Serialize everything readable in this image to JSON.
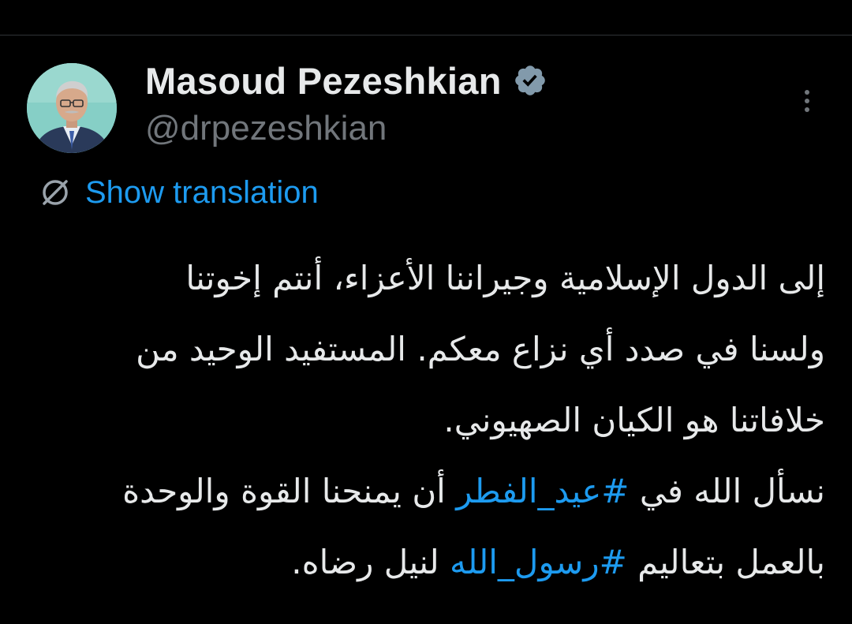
{
  "author": {
    "display_name": "Masoud Pezeshkian",
    "handle": "@drpezeshkian",
    "verified": true,
    "avatar_icon": "profile-photo"
  },
  "actions": {
    "more_icon": "more-vertical-icon",
    "translate_icon": "translate-icon",
    "show_translation_label": "Show translation"
  },
  "tweet": {
    "line1": "إلى الدول الإسلامية وجيراننا الأعزاء، أنتم إخوتنا",
    "line2": "ولسنا في صدد أي نزاع معكم. المستفيد الوحيد من",
    "line3": "خلافاتنا هو الكيان الصهيوني.",
    "line4_pre": "نسأل الله في ",
    "hashtag1": "#عيد_الفطر",
    "line4_post": " أن يمنحنا القوة والوحدة",
    "line5_pre": "بالعمل بتعاليم ",
    "hashtag2": "#رسول_الله",
    "line5_post": " لنيل رضاه."
  },
  "colors": {
    "background": "#000000",
    "text": "#e7e9ea",
    "secondary_text": "#71767b",
    "link": "#1d9bf0"
  }
}
